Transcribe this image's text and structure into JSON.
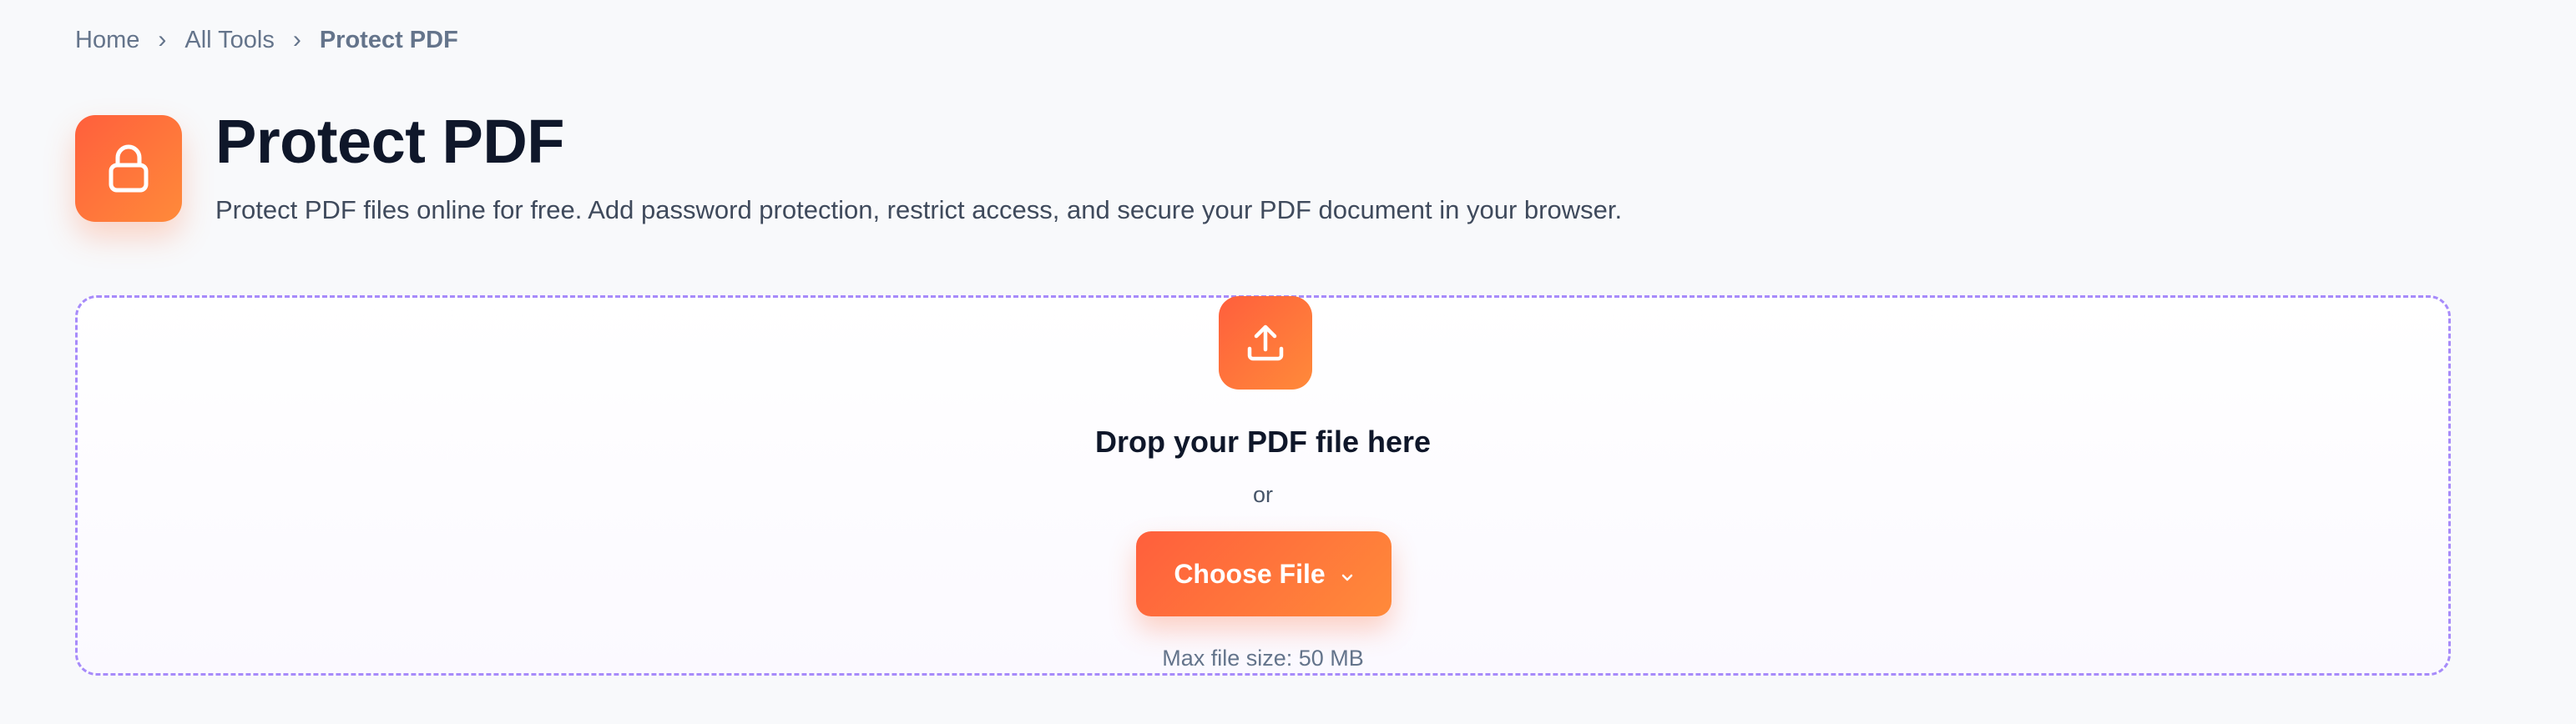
{
  "breadcrumb": {
    "items": [
      {
        "label": "Home"
      },
      {
        "label": "All Tools"
      },
      {
        "label": "Protect PDF"
      }
    ],
    "separator": "›"
  },
  "header": {
    "icon": "lock-icon",
    "title": "Protect PDF",
    "subtitle": "Protect PDF files online for free. Add password protection, restrict access, and secure your PDF document in your browser."
  },
  "dropzone": {
    "icon": "upload-icon",
    "title": "Drop your PDF file here",
    "or_text": "or",
    "button_label": "Choose File",
    "button_icon": "chevron-down-icon",
    "max_size": "Max file size: 50 MB"
  },
  "colors": {
    "accent_start": "#ff5f3c",
    "accent_end": "#ff8a3a",
    "dropzone_border": "#a78bfa",
    "background": "#f8f9fb"
  }
}
